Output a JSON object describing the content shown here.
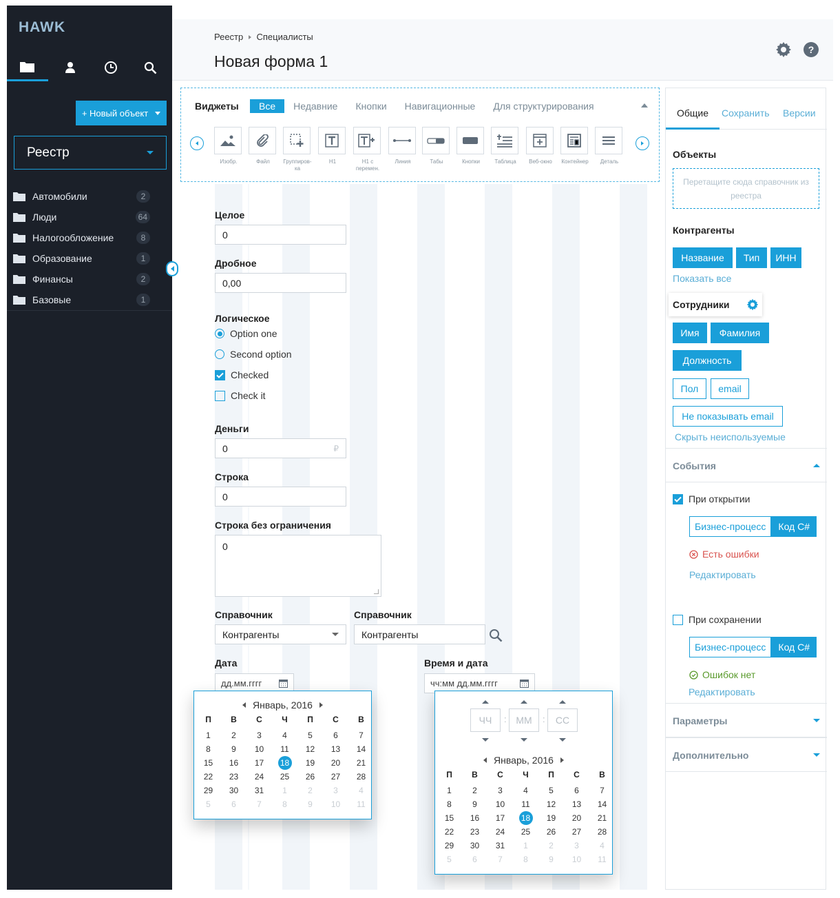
{
  "app": {
    "logo": "HAWK"
  },
  "sidebar": {
    "new_button": "+ Новый объект",
    "registry_select": "Реестр",
    "folders": [
      {
        "name": "Автомобили",
        "count": "2"
      },
      {
        "name": "Люди",
        "count": "64"
      },
      {
        "name": "Налогообложение",
        "count": "8"
      },
      {
        "name": "Образование",
        "count": "1"
      },
      {
        "name": "Финансы",
        "count": "2"
      },
      {
        "name": "Базовые",
        "count": "1"
      }
    ]
  },
  "header": {
    "breadcrumb_1": "Реестр",
    "breadcrumb_2": "Специалисты",
    "title": "Новая форма 1"
  },
  "widgets": {
    "title": "Виджеты",
    "tabs": [
      "Все",
      "Недавние",
      "Кнопки",
      "Навигационные",
      "Для структурирования"
    ],
    "items": [
      "Изобр.",
      "Файл",
      "Группиров-ка",
      "H1",
      "H1 с перемен.",
      "Линия",
      "Табы",
      "Кнопки",
      "Таблица",
      "Веб-окно",
      "Контейнер",
      "Деталь"
    ]
  },
  "form": {
    "int_label": "Целое",
    "int_value": "0",
    "frac_label": "Дробное",
    "frac_value": "0,00",
    "bool_label": "Логическое",
    "options": [
      "Option one",
      "Second option",
      "Checked",
      "Check it"
    ],
    "money_label": "Деньги",
    "money_value": "0",
    "money_symbol": "₽",
    "str_label": "Строка",
    "str_value": "0",
    "text_label": "Строка без ограничения",
    "text_value": "0",
    "ref1_label": "Справочник",
    "ref1_value": "Контрагенты",
    "ref2_label": "Справочник",
    "ref2_value": "Контрагенты",
    "date_label": "Дата",
    "date_placeholder": "дд.мм.гггг",
    "datetime_label": "Время и дата",
    "datetime_placeholder": "чч:мм  дд.мм.гггг"
  },
  "calendar": {
    "month": "Январь, 2016",
    "weekdays": [
      "П",
      "В",
      "С",
      "Ч",
      "П",
      "С",
      "В"
    ],
    "days": [
      "1",
      "2",
      "3",
      "4",
      "5",
      "6",
      "7",
      "8",
      "9",
      "10",
      "11",
      "12",
      "13",
      "14",
      "15",
      "16",
      "17",
      "18",
      "19",
      "20",
      "21",
      "22",
      "23",
      "24",
      "25",
      "26",
      "27",
      "28",
      "29",
      "30",
      "31",
      "1",
      "2",
      "3",
      "4",
      "5",
      "6",
      "7",
      "8",
      "9",
      "10",
      "11"
    ],
    "selected": "18",
    "time_placeholders": [
      "ЧЧ",
      "ММ",
      "СС"
    ]
  },
  "right_panel": {
    "tabs": [
      "Общие",
      "Сохранить",
      "Версии"
    ],
    "objects_title": "Объекты",
    "drop_hint": "Перетащите сюда справочник из реестра",
    "counterparties_title": "Контрагенты",
    "counterparty_tags": [
      "Название",
      "Тип",
      "ИНН"
    ],
    "show_all": "Показать все",
    "employees_title": "Сотрудники",
    "employee_tags_filled": [
      "Имя",
      "Фамилия",
      "Должность"
    ],
    "employee_tags_outline": [
      "Пол",
      "email",
      "Не показывать email"
    ],
    "hide_unused": "Скрыть неиспользуемые",
    "events_title": "События",
    "on_open": "При открытии",
    "bp_label": "Бизнес-процесс",
    "code_label": "Код C#",
    "has_errors": "Есть ошибки",
    "edit_label": "Редактировать",
    "on_save": "При сохранении",
    "no_errors": "Ошибок нет",
    "params_title": "Параметры",
    "extra_title": "Дополнительно"
  },
  "colors": {
    "accent": "#1a9fd9",
    "sidebar_bg": "#1b2029",
    "error": "#d9534f",
    "ok": "#5a9a2c"
  }
}
